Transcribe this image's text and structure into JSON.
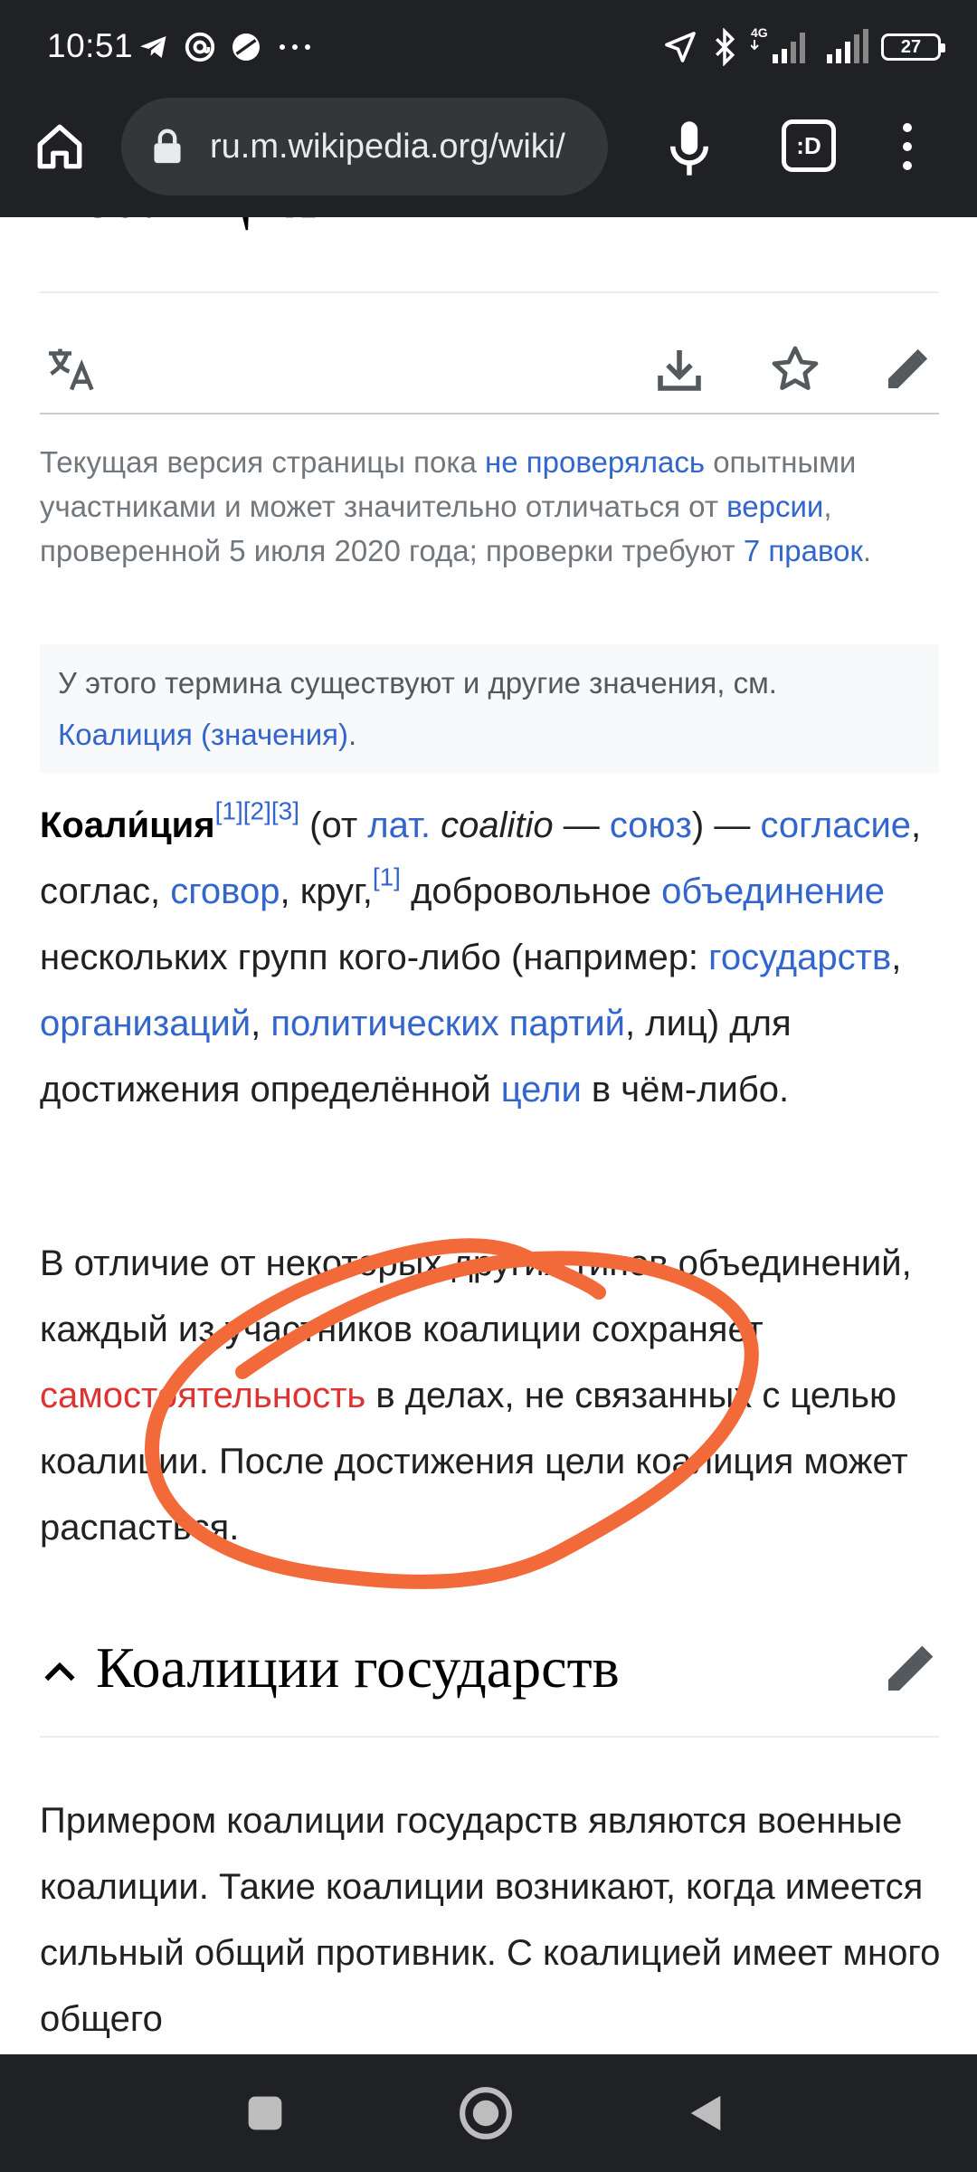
{
  "status": {
    "time": "10:51",
    "network": "4G",
    "battery": "27"
  },
  "toolbar": {
    "url": "ru.m.wikipedia.org/wiki/",
    "tab_label": ":D"
  },
  "page": {
    "heading": "Коалиция",
    "notice": {
      "t1": "Текущая версия страницы пока ",
      "l1": "не проверялась",
      "t2": " опытными участниками и может значительно отличаться от ",
      "l2": "версии",
      "t3": ", проверенной 5 июля 2020 года; проверки требуют ",
      "l3": "7 правок",
      "t4": "."
    },
    "hatnote": {
      "text": "У этого термина существуют и другие значения, см.",
      "link": "Коалиция (значения)",
      "end": "."
    },
    "intro": {
      "term": "Коали́ция",
      "ref1": "[1]",
      "ref2": "[2]",
      "ref3": "[3]",
      "t1": " (от ",
      "lat": "лат.",
      "latin_word": " coalitio",
      "t2": " — ",
      "soyuz": "союз",
      "t3": ") — ",
      "soglasie": "согласие",
      "t4": ", соглас, ",
      "sgovor": "сговор",
      "t5": ", круг,",
      "ref4": "[1]",
      "t6": " добровольное ",
      "obedinenie": "объединение",
      "t7": " нескольких групп кого-либо (например: ",
      "gosudarstv": "государств",
      "t8": ", ",
      "organizaciy": "организаций",
      "t9": ", ",
      "partiy": "политических партий",
      "t10": ", лиц) для достижения определённой ",
      "celi": "цели",
      "t11": " в чём-либо."
    },
    "para2": {
      "t1": "В отличие от некоторых других типов объединений, каждый из участников коалиции сохраняет ",
      "link_red": "самостоятельность",
      "t2": " в делах, не связанных с целью коалиции. После достижения цели коалиция может распасться."
    },
    "section": {
      "title": "Коалиции государств"
    },
    "para3": {
      "text": "Примером коалиции государств являются военные коалиции. Такие коалиции возникают, когда имеется сильный общий противник. С коалицией имеет много общего "
    }
  },
  "annotation": {
    "color": "#f26a3a"
  },
  "icons": {
    "home": "home-icon",
    "lock": "lock-icon",
    "mic": "mic-icon",
    "menu": "more-vert-icon",
    "language": "translate-icon",
    "download": "download-icon",
    "star": "star-icon",
    "edit": "pencil-icon",
    "collapse": "chevron-up-icon"
  }
}
